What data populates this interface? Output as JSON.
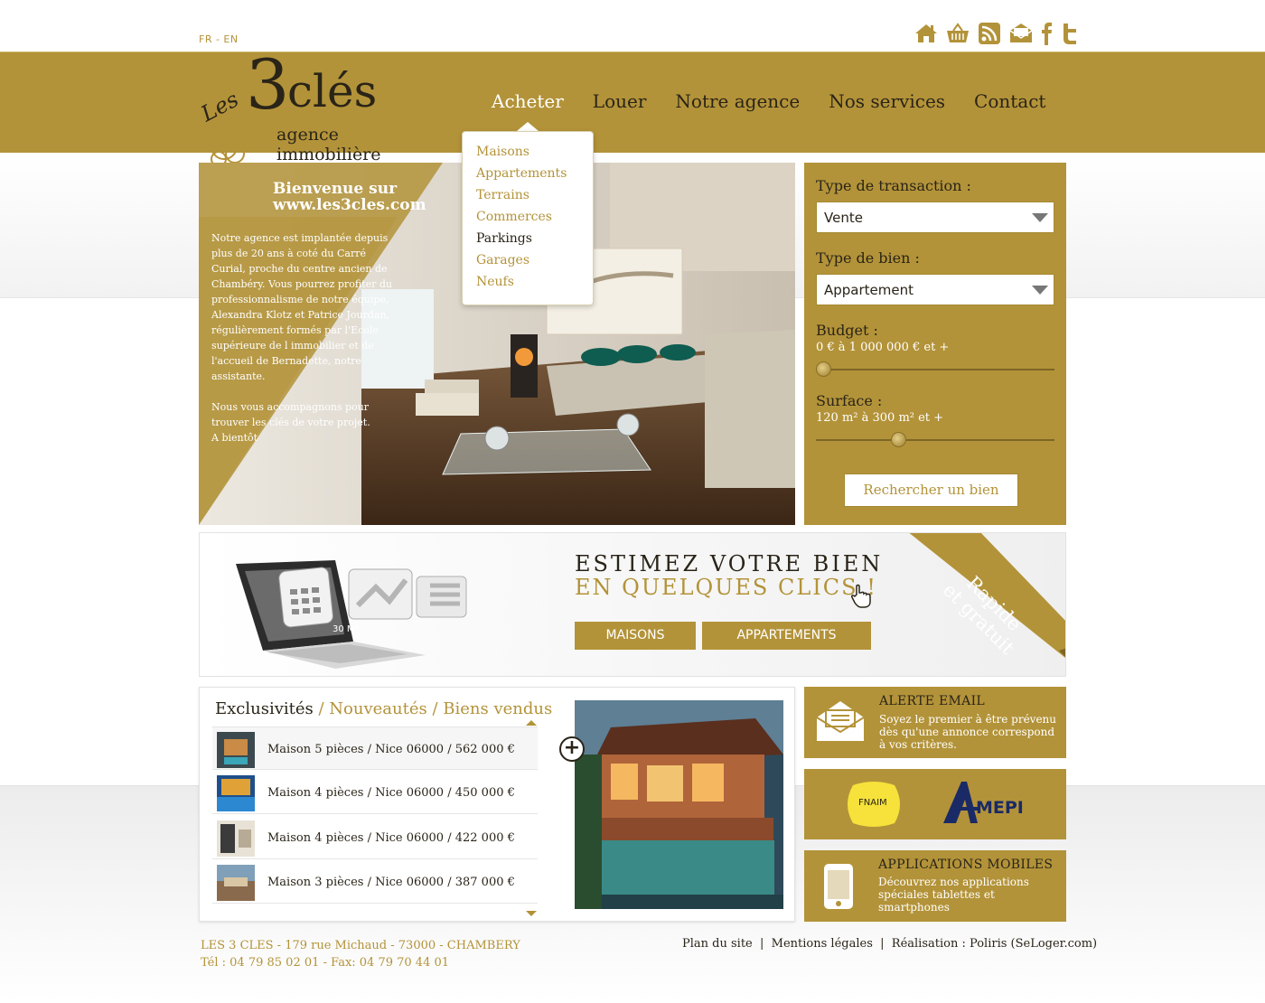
{
  "lang": "FR - EN",
  "social": [
    "home-icon",
    "basket-icon",
    "rss-icon",
    "mail-icon",
    "facebook-icon",
    "twitter-icon"
  ],
  "logo": {
    "les": "Les",
    "three": "3",
    "cles": "clés",
    "sub": "agence immobilière"
  },
  "nav": [
    "Acheter",
    "Louer",
    "Notre agence",
    "Nos services",
    "Contact"
  ],
  "dropdown": [
    "Maisons",
    "Appartements",
    "Terrains",
    "Commerces",
    "Parkings",
    "Garages",
    "Neufs"
  ],
  "hero": {
    "welcome1": "Bienvenue sur",
    "welcome2": "www.les3cles.com",
    "text1": "Notre agence est implantée depuis plus de 20 ans à coté du Carré Curial, proche du centre ancien de Chambéry. Vous pourrez profiter du professionnalisme de notre équipe, Alexandra Klotz et Patrice Jourdan, régulièrement formés par l'Ecole supérieure de l immobilier et de l'accueil de Bernadette, notre assistante.",
    "text2": "Nous vous accompagnons pour trouver les clés de votre projet.",
    "text3": "A bientôt"
  },
  "search": {
    "transaction_label": "Type de transaction :",
    "transaction_value": "Vente",
    "bien_label": "Type de bien :",
    "bien_value": "Appartement",
    "budget_label": "Budget :",
    "budget_range": "0 € à 1 000 000 € et +",
    "surface_label": "Surface :",
    "surface_range": "120 m² à 300 m² et +",
    "button": "Rechercher un bien"
  },
  "estimate": {
    "line1": "ESTIMEZ VOTRE BIEN",
    "line2": "EN QUELQUES CLICS !",
    "btn_maisons": "MAISONS",
    "btn_apparts": "APPARTEMENTS",
    "ribbon1": "Rapide",
    "ribbon2": "et gratuit",
    "screen_text": "30 M²"
  },
  "listings": {
    "tab_active": "Exclusivités",
    "tab_sep1": " / ",
    "tab2": "Nouveautés",
    "tab_sep2": " / ",
    "tab3": "Biens vendus",
    "items": [
      "Maison 5 pièces / Nice 06000 / 562 000 €",
      "Maison 4 pièces / Nice 06000 / 450 000 €",
      "Maison 4 pièces / Nice 06000 / 422 000 €",
      "Maison 3 pièces / Nice 06000 / 387 000 €"
    ]
  },
  "alert": {
    "title": "ALERTE EMAIL",
    "desc": "Soyez le premier à être prévenu dès qu'une annonce correspond à vos critères."
  },
  "partners": {
    "fnaim": "FNAIM",
    "amepi": "MEPI"
  },
  "apps": {
    "title": "APPLICATIONS MOBILES",
    "desc": "Découvrez nos applications spéciales tablettes et smartphones"
  },
  "footer": {
    "address": "LES 3 CLES - 179 rue Michaud - 73000 - CHAMBERY",
    "phone": "Tél : 04 79 85 02 01 - Fax: 04 79 70 44 01",
    "plan": "Plan du site",
    "mentions": "Mentions légales",
    "realisation": "Réalisation : Poliris (SeLoger.com)",
    "sep": "  |  "
  },
  "colors": {
    "gold": "#b39339",
    "dark": "#2a2418"
  }
}
